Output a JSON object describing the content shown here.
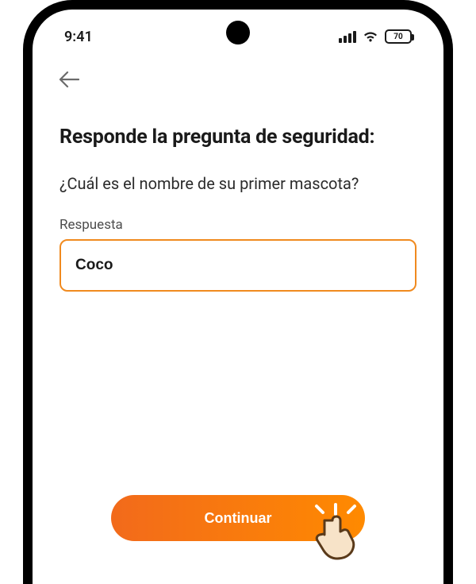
{
  "status_bar": {
    "time": "9:41",
    "battery": "70"
  },
  "page": {
    "title": "Responde la pregunta de seguridad:",
    "question": "¿Cuál es el nombre de su primer mascota?",
    "answer_label": "Respuesta",
    "answer_value": "Coco",
    "continue_label": "Continuar"
  }
}
